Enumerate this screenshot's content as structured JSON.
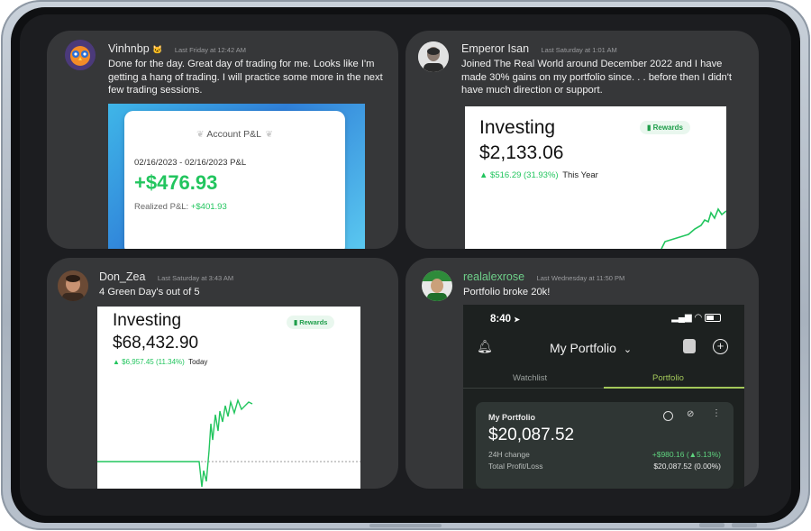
{
  "posts": [
    {
      "username": "Vinhnbp",
      "badge": "🐱",
      "timestamp": "Last Friday at 12:42 AM",
      "message": "Done for the day. Great day of trading for me. Looks like I'm getting a hang of trading. I will practice some more in the next few trading sessions.",
      "screenshot": {
        "title": "Account P&L",
        "date_range": "02/16/2023 - 02/16/2023 P&L",
        "amount": "+$476.93",
        "realized_label": "Realized P&L:",
        "realized_value": "+$401.93"
      }
    },
    {
      "username": "Emperor Isan",
      "timestamp": "Last Saturday at 1:01 AM",
      "message": "Joined The Real World around December 2022 and I have made 30% gains on my portfolio since. . . before then I didn't have much direction or support.",
      "screenshot": {
        "title": "Investing",
        "amount": "$2,133.06",
        "change": "▲ $516.29 (31.93%)",
        "period": "This Year",
        "rewards_label": "Rewards"
      }
    },
    {
      "username": "Don_Zea",
      "timestamp": "Last Saturday at 3:43 AM",
      "message": "4 Green Day's out of 5",
      "screenshot": {
        "title": "Investing",
        "amount": "$68,432.90",
        "change": "▲ $6,957.45 (11.34%)",
        "period": "Today",
        "rewards_label": "Rewards"
      }
    },
    {
      "username": "realalexrose",
      "timestamp": "Last Wednesday at 11:50 PM",
      "message": "Portfolio broke 20k!",
      "screenshot": {
        "time": "8:40",
        "title": "My Portfolio",
        "tab_watchlist": "Watchlist",
        "tab_portfolio": "Portfolio",
        "card_title": "My Portfolio",
        "card_value": "$20,087.52",
        "change_label": "24H change",
        "change_value": "+$980.16 (▲5.13%)",
        "profit_label": "Total Profit/Loss",
        "profit_value": "$20,087.52 (0.00%)"
      }
    }
  ],
  "colors": {
    "gain_green": "#22c55e",
    "card_bg": "#363739",
    "screen_bg": "#1c1d20",
    "portfolio_accent": "#a3c85a"
  }
}
